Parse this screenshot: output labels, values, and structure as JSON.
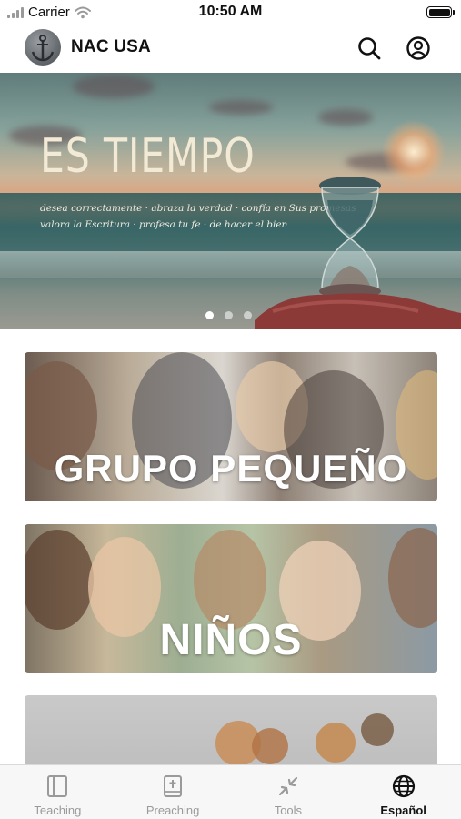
{
  "status_bar": {
    "carrier": "Carrier",
    "time": "10:50 AM",
    "icons": [
      "signal-icon",
      "wifi-icon",
      "battery-icon"
    ]
  },
  "header": {
    "title": "NAC USA",
    "logo_icon": "anchor-logo-icon",
    "search_icon": "search-icon",
    "account_icon": "account-icon"
  },
  "banner": {
    "title": "ES TIEMPO",
    "subtitle_line1": "desea correctamente · abraza la verdad · confía en Sus promesas",
    "subtitle_line2": "valora la Escritura · profesa tu fe · de hacer el bien",
    "slide_count": 3,
    "active_slide": 1
  },
  "cards": [
    {
      "label": "GRUPO PEQUEÑO"
    },
    {
      "label": "NIÑOS"
    },
    {
      "label": ""
    }
  ],
  "tabs": [
    {
      "label": "Teaching",
      "icon": "book-icon",
      "active": false
    },
    {
      "label": "Preaching",
      "icon": "bible-icon",
      "active": false
    },
    {
      "label": "Tools",
      "icon": "collapse-arrows-icon",
      "active": false
    },
    {
      "label": "Español",
      "icon": "globe-icon",
      "active": true
    }
  ],
  "colors": {
    "accent": "#111111",
    "inactive_tab": "#9a9a9a",
    "tab_bar_bg": "#f7f7f7"
  }
}
